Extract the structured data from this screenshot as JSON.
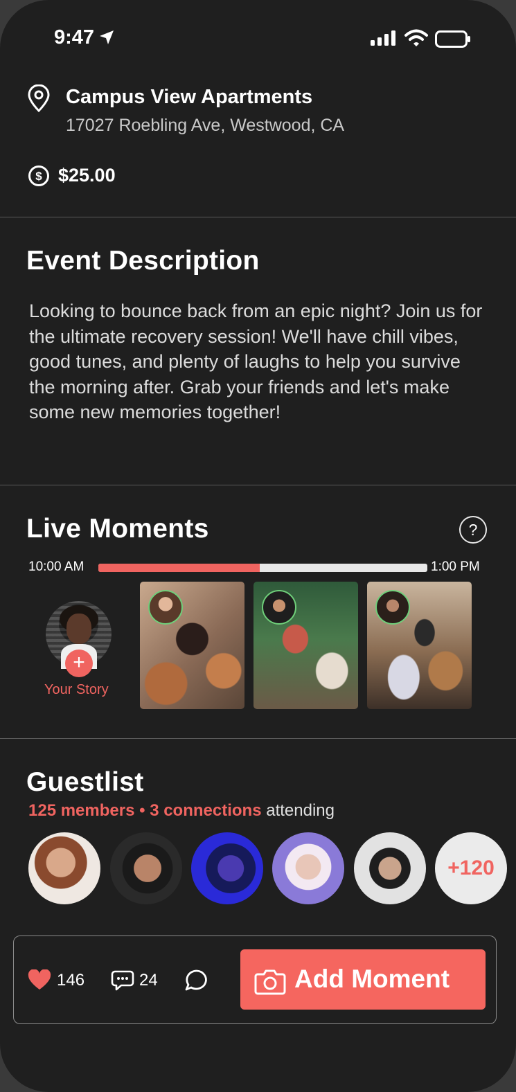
{
  "status_bar": {
    "time": "9:47"
  },
  "location": {
    "venue": "Campus View Apartments",
    "address": "17027 Roebling Ave, Westwood, CA"
  },
  "price": "$25.00",
  "description": {
    "title": "Event Description",
    "body": "Looking to bounce back from an epic night? Join us for the ultimate recovery session! We'll have chill vibes, good tunes, and plenty of laughs to help you survive the morning after. Grab your friends and let's make some new memories together!"
  },
  "live_moments": {
    "title": "Live Moments",
    "help": "?",
    "timeline_start": "10:00 AM",
    "timeline_end": "1:00 PM",
    "timeline_progress": 0.49,
    "your_story_label": "Your Story",
    "story_add": "+"
  },
  "guestlist": {
    "title": "Guestlist",
    "members": "125 members",
    "separator": " • ",
    "connections": "3 connections",
    "suffix": " attending",
    "more_count": "+120"
  },
  "action_bar": {
    "likes": "146",
    "comments": "24",
    "add_moment_label": "Add Moment"
  },
  "colors": {
    "accent": "#f06460",
    "background": "#1f1f1f",
    "online_ring": "#6fcf7a"
  }
}
